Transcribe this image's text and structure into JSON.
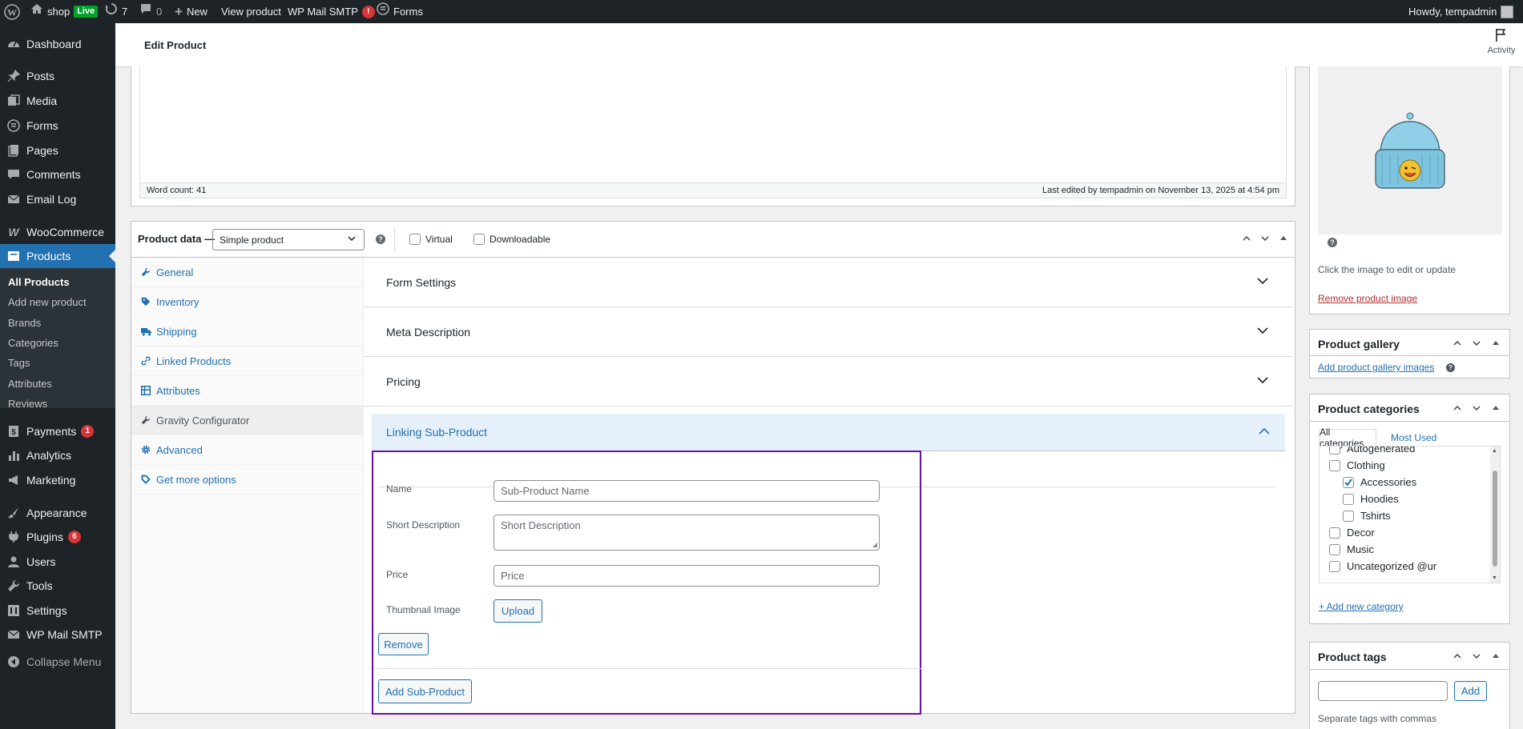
{
  "adminbar": {
    "site_name": "shop",
    "live_badge": "Live",
    "updates_count": "7",
    "comments_count": "0",
    "new_label": "New",
    "view_product": "View product",
    "wp_mail_smtp": "WP Mail SMTP",
    "wp_mail_smtp_alert": "!",
    "forms": "Forms",
    "howdy": "Howdy, tempadmin"
  },
  "sidebar": {
    "dashboard": "Dashboard",
    "posts": "Posts",
    "media": "Media",
    "forms": "Forms",
    "pages": "Pages",
    "comments": "Comments",
    "email_log": "Email Log",
    "woocommerce": "WooCommerce",
    "products": "Products",
    "submenu": [
      "All Products",
      "Add new product",
      "Brands",
      "Categories",
      "Tags",
      "Attributes",
      "Reviews"
    ],
    "payments": "Payments",
    "payments_count": "1",
    "analytics": "Analytics",
    "marketing": "Marketing",
    "appearance": "Appearance",
    "plugins": "Plugins",
    "plugins_count": "6",
    "users": "Users",
    "tools": "Tools",
    "settings": "Settings",
    "wp_mail_smtp": "WP Mail SMTP",
    "collapse": "Collapse Menu"
  },
  "header": {
    "title": "Edit Product",
    "activity": "Activity"
  },
  "editor": {
    "word_count": "Word count: 41",
    "last_edited": "Last edited by tempadmin on November 13, 2025 at 4:54 pm"
  },
  "product_data": {
    "label": "Product data —",
    "type_value": "Simple product",
    "virtual_label": "Virtual",
    "downloadable_label": "Downloadable",
    "tabs": [
      "General",
      "Inventory",
      "Shipping",
      "Linked Products",
      "Attributes",
      "Gravity Configurator",
      "Advanced",
      "Get more options"
    ],
    "sections": {
      "form_settings": "Form Settings",
      "meta_description": "Meta Description",
      "pricing": "Pricing",
      "linking_sub_product": "Linking Sub-Product"
    },
    "sub_product": {
      "name_label": "Name",
      "name_placeholder": "Sub-Product Name",
      "short_desc_label": "Short Description",
      "short_desc_placeholder": "Short Description",
      "price_label": "Price",
      "price_placeholder": "Price",
      "thumbnail_label": "Thumbnail Image",
      "upload_button": "Upload",
      "remove_button": "Remove",
      "add_button": "Add Sub-Product"
    }
  },
  "product_image": {
    "help_icon": "?",
    "edit_hint": "Click the image to edit or update",
    "remove_link": "Remove product image"
  },
  "product_gallery": {
    "title": "Product gallery",
    "add_link": "Add product gallery images"
  },
  "product_categories": {
    "title": "Product categories",
    "tab_all": "All categories",
    "tab_most_used": "Most Used",
    "items": [
      {
        "label": "Autogenerated",
        "checked": false,
        "child": false
      },
      {
        "label": "Clothing",
        "checked": false,
        "child": false
      },
      {
        "label": "Accessories",
        "checked": true,
        "child": true
      },
      {
        "label": "Hoodies",
        "checked": false,
        "child": true
      },
      {
        "label": "Tshirts",
        "checked": false,
        "child": true
      },
      {
        "label": "Decor",
        "checked": false,
        "child": false
      },
      {
        "label": "Music",
        "checked": false,
        "child": false
      },
      {
        "label": "Uncategorized @ur",
        "checked": false,
        "child": false
      }
    ],
    "add_new": "+ Add new category"
  },
  "product_tags": {
    "title": "Product tags",
    "add_button": "Add",
    "hint": "Separate tags with commas"
  },
  "colors": {
    "admin_dark": "#1d2327",
    "accent": "#2271b1",
    "highlight_box": "#6b0fa8",
    "alert_red": "#d63638"
  }
}
